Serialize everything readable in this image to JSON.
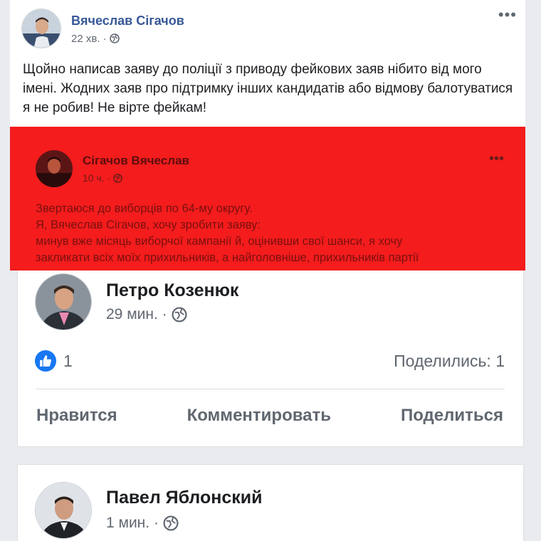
{
  "top_post": {
    "author": "Вячеслав Сігачов",
    "time": "22 хв. ·",
    "menu_icon": "more-dots-icon",
    "text": "Щойно написав заяву до поліції з приводу фейкових заяв нібито від мого імені. Жодних заяв про підтримку інших кандидатів або відмову балотуватися я не робив! Не вірте фейкам!"
  },
  "shared_post": {
    "author": "Сігачов Вячеслав",
    "time": "10 ч. ·",
    "lines": [
      "Звертаюся до виборців по 64-му округу.",
      "Я, Вячеслав Сігачов, хочу зробити заяву:",
      "минув вже місяць виборчої кампанії й, оцінивши свої шанси, я хочу",
      "закликати всіх моїх прихильників, а найголовніше, прихильників партії"
    ],
    "background": "#f41c1c"
  },
  "petro_post": {
    "author": "Петро Козенюк",
    "time": "29 мин. ·",
    "like_count": "1",
    "shares": "Поделились: 1",
    "actions": {
      "like": "Нравится",
      "comment": "Комментировать",
      "share": "Поделиться"
    }
  },
  "pavel_post": {
    "author": "Павел Яблонский",
    "time": "1 мин. ·"
  },
  "colors": {
    "link_blue": "#385898",
    "like_blue": "#1877f2",
    "meta_gray": "#606770"
  }
}
